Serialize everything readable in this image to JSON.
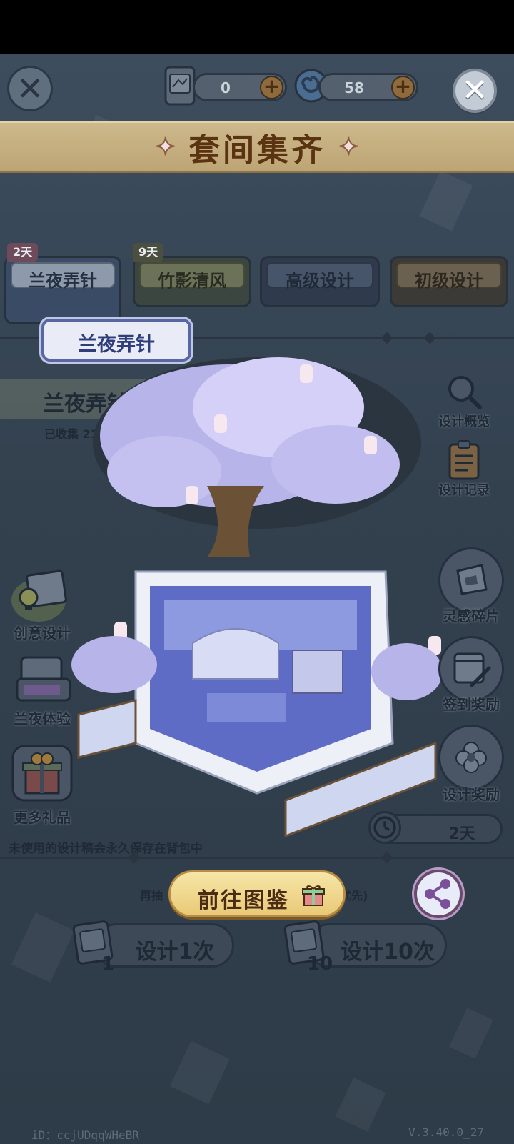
{
  "header": {
    "close_left_glyph": "✕",
    "close_right_glyph": "✕",
    "design_ticket_count": "0",
    "swirl_currency_count": "58",
    "add_glyph": "+"
  },
  "banner": {
    "title": "套间集齐",
    "star": "✦"
  },
  "tabs": [
    {
      "label": "兰夜弄针",
      "days": "2天"
    },
    {
      "label": "竹影清风",
      "days": "9天"
    },
    {
      "label": "高级设计"
    },
    {
      "label": "初级设计"
    }
  ],
  "suit": {
    "badge": "兰夜弄针",
    "name": "兰夜弄针",
    "collected": "已收集 21/21"
  },
  "left_menu": {
    "creative": "创意设计",
    "experience": "兰夜体验",
    "gifts": "更多礼品"
  },
  "right_menu": {
    "overview": "设计概览",
    "records": "设计记录",
    "fragments": "灵感碎片",
    "checkin": "签到奖励",
    "rewards": "设计奖励"
  },
  "timer": {
    "days": "2天"
  },
  "note": "未使用的设计稿会永久保存在背包中",
  "redraw_hint": {
    "left": "再抽",
    "right": "优先)"
  },
  "goto_button": "前往图鉴",
  "design_once": {
    "label": "设计1次",
    "cost": "1"
  },
  "design_ten": {
    "label": "设计10次",
    "cost": "10"
  },
  "footer": {
    "id": "iD：ccjUDqqWHeBR",
    "version": "V.3.40.0_27"
  },
  "colors": {
    "accent_gold": "#e9c977",
    "banner": "#cdb98c",
    "badge_purple": "#5867a1"
  }
}
